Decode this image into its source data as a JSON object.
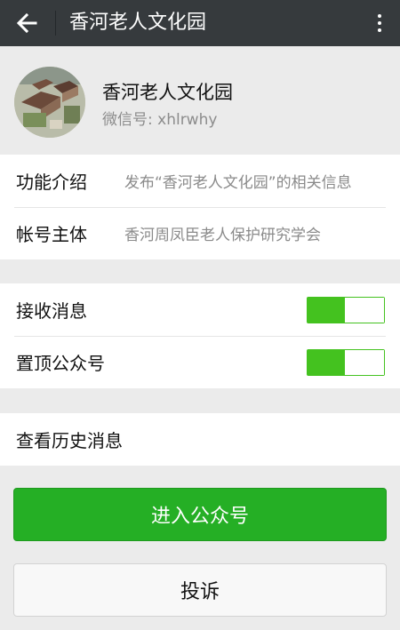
{
  "topbar": {
    "title": "香河老人文化园",
    "back_icon": "arrow-left-icon",
    "more_icon": "more-vertical-icon"
  },
  "profile": {
    "name": "香河老人文化园",
    "wechat_id": "微信号: xhlrwhy"
  },
  "info": {
    "function_label": "功能介绍",
    "function_value": "发布“香河老人文化园”的相关信息",
    "owner_label": "帐号主体",
    "owner_value": "香河周凤臣老人保护研究学会"
  },
  "settings": {
    "receive_label": "接收消息",
    "receive_on": true,
    "pin_label": "置顶公众号",
    "pin_on": true
  },
  "history": {
    "label": "查看历史消息"
  },
  "actions": {
    "enter_label": "进入公众号",
    "complain_label": "投诉"
  },
  "colors": {
    "topbar": "#363a3d",
    "accent_green": "#44c21f",
    "button_green": "#25af25",
    "background": "#ebebeb"
  }
}
